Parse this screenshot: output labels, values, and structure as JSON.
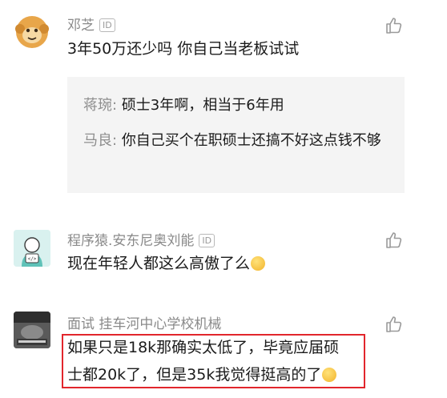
{
  "id_badge_text": "ID",
  "comments": [
    {
      "username": "邓芝",
      "text": "3年50万还少吗 你自己当老板试试",
      "replies": [
        {
          "author": "蒋琬:",
          "text": "硕士3年啊，相当于6年用"
        },
        {
          "author": "马良:",
          "text": "你自己买个在职硕士还搞不好这点钱不够"
        }
      ]
    },
    {
      "username": "程序猿.安东尼奥刘能",
      "text": "现在年轻人都这么高傲了么"
    },
    {
      "username": "面试 挂车河中心学校机械",
      "text_line1": "如果只是18k那确实太低了，毕竟应届硕",
      "text_line2": "士都20k了，但是35k我觉得挺高的了"
    }
  ],
  "colors": {
    "highlight_border": "#e2262c",
    "username": "#8a8a8a",
    "reply_bg": "#f4f4f4"
  }
}
